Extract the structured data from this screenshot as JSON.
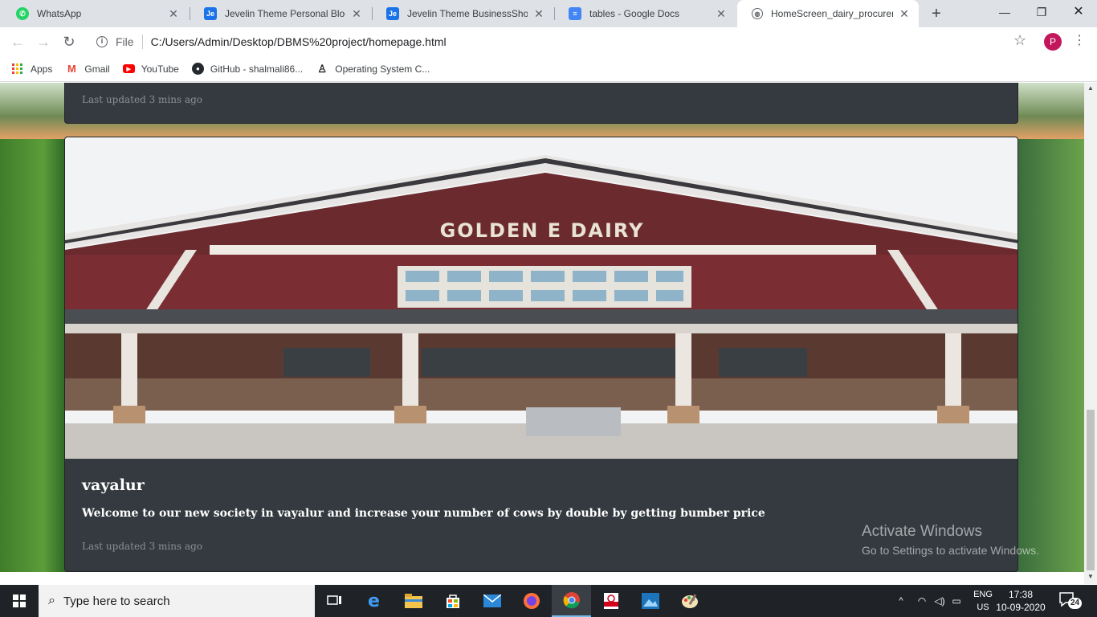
{
  "browser": {
    "tabs": [
      {
        "title": "WhatsApp",
        "icon": "whatsapp-icon",
        "color": "#25d366",
        "active": false
      },
      {
        "title": "Jevelin Theme Personal Blog D",
        "icon": "jevelin-icon",
        "color": "#1a73e8",
        "active": false
      },
      {
        "title": "Jevelin Theme BusinessShop D",
        "icon": "jevelin-icon",
        "color": "#1a73e8",
        "active": false
      },
      {
        "title": "tables - Google Docs",
        "icon": "google-docs-icon",
        "color": "#4285f4",
        "active": false
      },
      {
        "title": "HomeScreen_dairy_procureme",
        "icon": "globe-icon",
        "color": "#5f6368",
        "active": true
      }
    ],
    "address": {
      "scheme": "File",
      "url": "C:/Users/Admin/Desktop/DBMS%20project/homepage.html"
    },
    "profile_initial": "P",
    "bookmarks": [
      {
        "label": "Apps",
        "icon": "apps-grid-icon"
      },
      {
        "label": "Gmail",
        "icon": "gmail-icon"
      },
      {
        "label": "YouTube",
        "icon": "youtube-icon"
      },
      {
        "label": "GitHub - shalmali86...",
        "icon": "github-icon"
      },
      {
        "label": "Operating System C...",
        "icon": "linux-penguin-icon"
      }
    ]
  },
  "page": {
    "top_card": {
      "updated": "Last updated 3 mins ago"
    },
    "main_card": {
      "image_sign": "GOLDEN E DAIRY",
      "title": "vayalur",
      "text": "Welcome to our new society in vayalur and increase your number of cows by double by getting bumber price",
      "updated": "Last updated 3 mins ago"
    },
    "watermark": {
      "line1": "Activate Windows",
      "line2": "Go to Settings to activate Windows."
    }
  },
  "taskbar": {
    "search_placeholder": "Type here to search",
    "language": {
      "line1": "ENG",
      "line2": "US"
    },
    "time": "17:38",
    "date": "10-09-2020",
    "notifications": "24",
    "apps": [
      "task-view-icon",
      "edge-icon",
      "file-explorer-icon",
      "store-icon",
      "mail-icon",
      "firefox-icon",
      "chrome-icon",
      "pdf-icon",
      "photos-icon",
      "paint-icon"
    ]
  }
}
